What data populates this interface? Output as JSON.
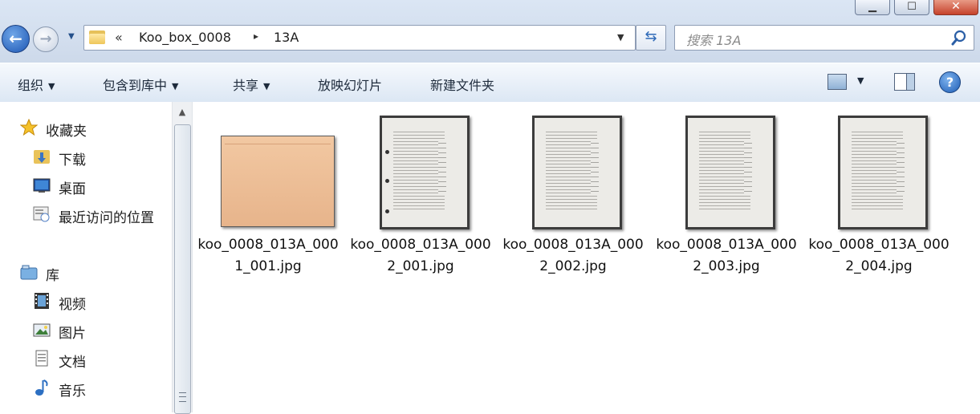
{
  "window": {
    "minimize_glyph": "▁",
    "maximize_glyph": "☐",
    "close_glyph": "✕"
  },
  "navigation": {
    "back_glyph": "←",
    "forward_glyph": "→"
  },
  "address": {
    "overflow": "«",
    "crumbs": [
      "Koo_box_0008",
      "13A"
    ],
    "separator": "▸"
  },
  "search": {
    "placeholder": "搜索 13A"
  },
  "toolbar": {
    "organize": "组织",
    "include_in_library": "包含到库中",
    "share": "共享",
    "slideshow": "放映幻灯片",
    "new_folder": "新建文件夹",
    "help_glyph": "?"
  },
  "sidebar": {
    "favorites": {
      "label": "收藏夹",
      "items": [
        {
          "label": "下载",
          "icon": "download-folder-icon"
        },
        {
          "label": "桌面",
          "icon": "desktop-icon"
        },
        {
          "label": "最近访问的位置",
          "icon": "recent-places-icon"
        }
      ]
    },
    "libraries": {
      "label": "库",
      "items": [
        {
          "label": "视频",
          "icon": "video-icon"
        },
        {
          "label": "图片",
          "icon": "pictures-icon"
        },
        {
          "label": "文档",
          "icon": "documents-icon"
        },
        {
          "label": "音乐",
          "icon": "music-icon"
        }
      ]
    }
  },
  "files": [
    {
      "name": "koo_0008_013A_0001_001.jpg",
      "thumbnail": "envelope"
    },
    {
      "name": "koo_0008_013A_0002_001.jpg",
      "thumbnail": "document"
    },
    {
      "name": "koo_0008_013A_0002_002.jpg",
      "thumbnail": "document"
    },
    {
      "name": "koo_0008_013A_0002_003.jpg",
      "thumbnail": "document"
    },
    {
      "name": "koo_0008_013A_0002_004.jpg",
      "thumbnail": "document"
    }
  ]
}
